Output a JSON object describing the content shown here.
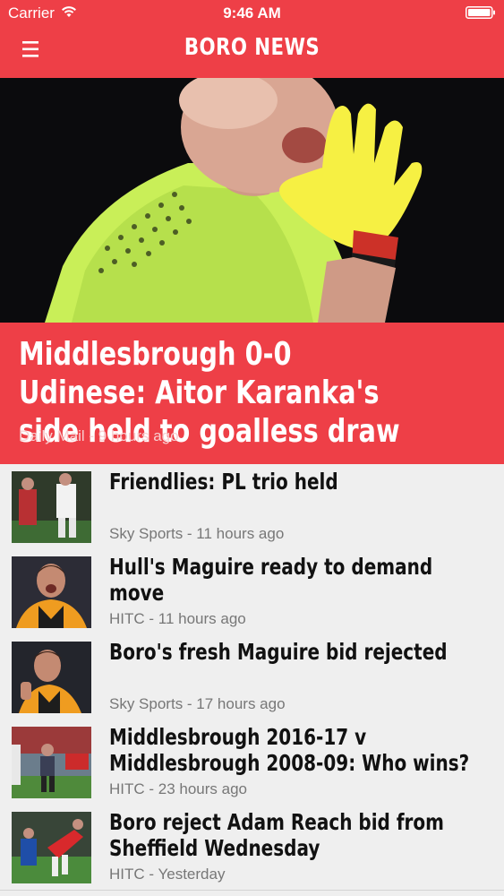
{
  "status_bar": {
    "carrier": "Carrier",
    "time": "9:46 AM"
  },
  "header": {
    "title": "BORO NEWS"
  },
  "hero": {
    "title": "Middlesbrough 0-0 Udinese: Aitor Karanka's side held to goalless draw",
    "meta": "Daily Mail - 9 hours ago"
  },
  "news": [
    {
      "title": "Friendlies: PL trio held",
      "meta": "Sky Sports - 11 hours ago"
    },
    {
      "title": "Hull's Maguire ready to demand move",
      "meta": "HITC - 11 hours ago"
    },
    {
      "title": "Boro's fresh Maguire bid rejected",
      "meta": "Sky Sports - 17 hours ago"
    },
    {
      "title": "Middlesbrough 2016-17 v Middlesbrough 2008-09: Who wins?",
      "meta": "HITC - 23 hours ago"
    },
    {
      "title": "Boro reject Adam Reach bid from Sheffield Wednesday",
      "meta": "HITC - Yesterday"
    }
  ],
  "colors": {
    "accent": "#ee3f47",
    "background": "#efefef",
    "meta_text": "#777777"
  },
  "icons": [
    "wifi-icon",
    "battery-icon",
    "hamburger-menu-icon"
  ]
}
